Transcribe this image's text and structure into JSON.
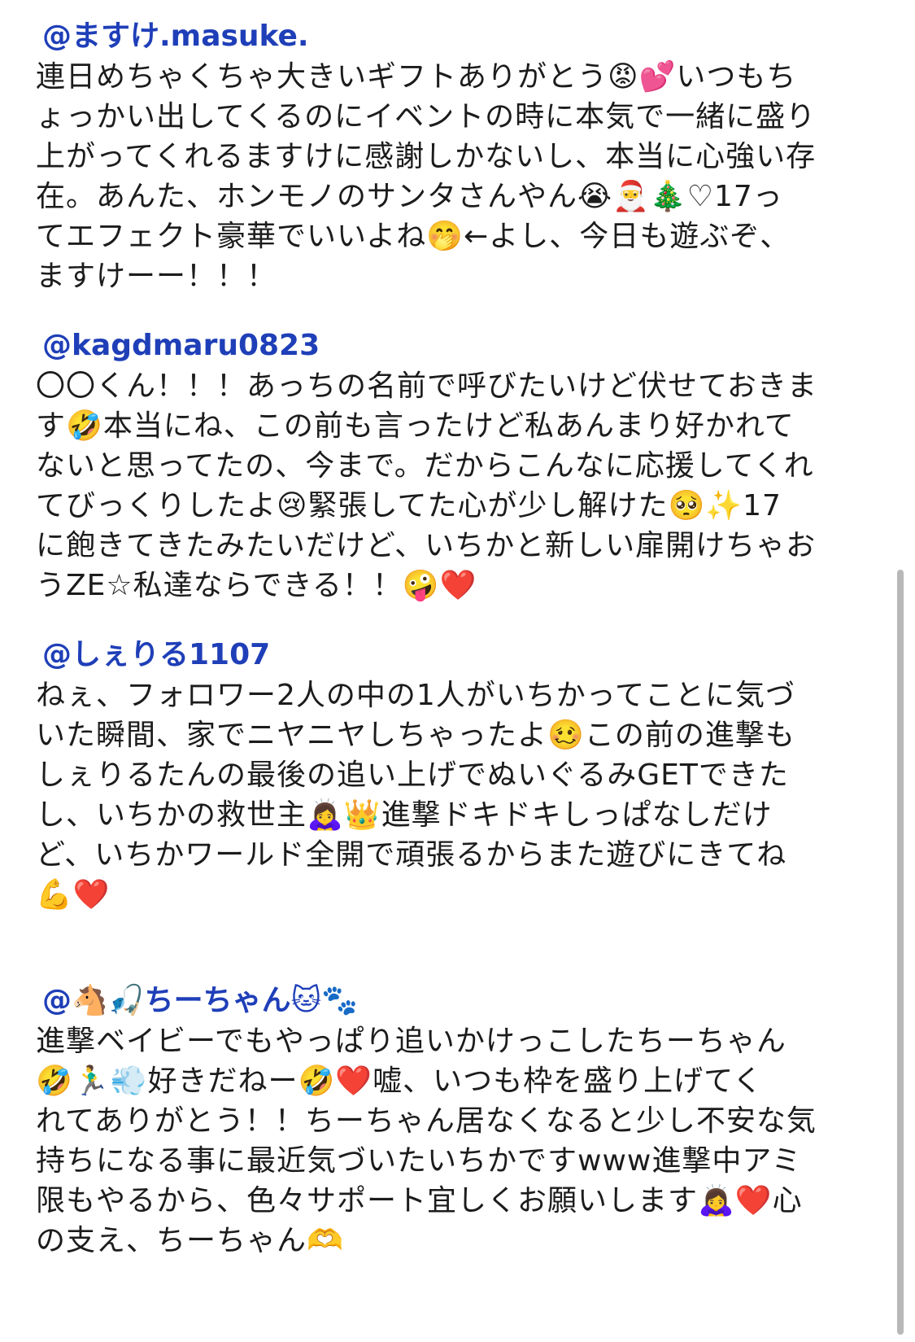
{
  "messages": [
    {
      "handle": "@ますけ.masuke.",
      "lines": [
        "連日めちゃくちゃ大きいギフトありがとう😡💕いつもち",
        "ょっかい出してくるのにイベントの時に本気で一緒に盛り",
        "上がってくれるますけに感謝しかないし、本当に心強い存",
        "在。あんた、ホンモノのサンタさんやん😭🎅🎄♡17っ",
        "てエフェクト豪華でいいよね🤭←よし、今日も遊ぶぞ、",
        "ますけーー！！！"
      ]
    },
    {
      "handle": "@kagdmaru0823",
      "lines": [
        "〇〇くん！！！あっちの名前で呼びたいけど伏せておきま",
        "す🤣本当にね、この前も言ったけど私あんまり好かれて",
        "ないと思ってたの、今まで。だからこんなに応援してくれ",
        "てびっくりしたよ😢緊張してた心が少し解けた🥺✨17",
        "に飽きてきたみたいだけど、いちかと新しい扉開けちゃお",
        "うZE☆私達ならできる！！🤪❤️"
      ]
    },
    {
      "handle": "@しぇりる1107",
      "lines": [
        "ねぇ、フォロワー2人の中の1人がいちかってことに気づ",
        "いた瞬間、家でニヤニヤしちゃったよ🥴この前の進撃も",
        "しぇりるたんの最後の追い上げでぬいぐるみGETできた",
        "し、いちかの救世主🙇‍♀️👑進撃ドキドキしっぱなしだけ",
        "ど、いちかワールド全開で頑張るからまた遊びにきてね",
        "💪❤️"
      ]
    },
    {
      "handle": "@🐴🎣ちーちゃん🐱🐾",
      "lines": [
        "進撃ベイビーでもやっぱり追いかけっこしたちーちゃん",
        "🤣🏃‍♂️💨好きだねー🤣❤️嘘、いつも枠を盛り上げてく",
        "れてありがとう！！ちーちゃん居なくなると少し不安な気",
        "持ちになる事に最近気づいたいちかですwww進撃中アミ",
        "限もやるから、色々サポート宜しくお願いします🙇‍♀️❤️心",
        "の支え、ちーちゃん🫶"
      ]
    }
  ],
  "colors": {
    "handle": "#1f3fb8",
    "text": "#1c1c1c",
    "background": "#ffffff",
    "scrollbar": "#b8b8b8"
  }
}
